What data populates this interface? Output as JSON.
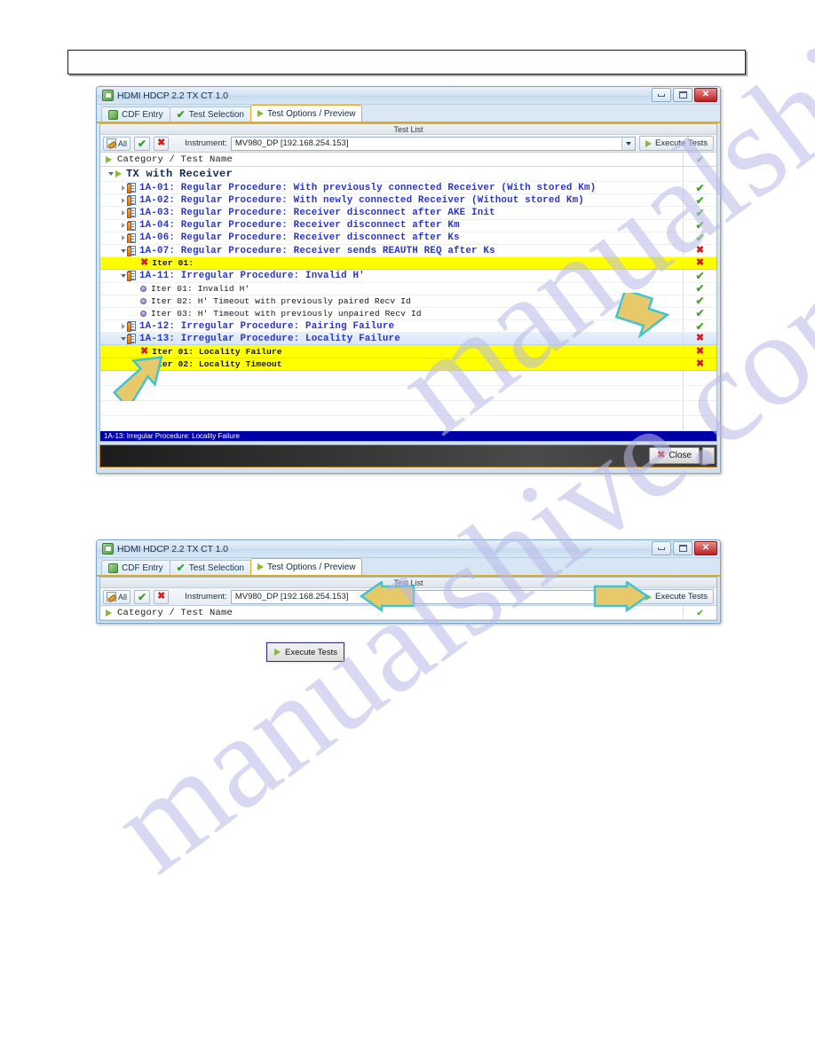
{
  "page": {
    "watermark": "manualshive.com",
    "header_box_text": ""
  },
  "window1": {
    "title": "HDMI HDCP 2.2 TX CT 1.0",
    "window_buttons": {
      "minimize": "—",
      "maximize": "❐",
      "close": "✕"
    },
    "tabs": [
      {
        "label": "CDF Entry",
        "icon": "cdf-icon",
        "active": false
      },
      {
        "label": "Test Selection",
        "icon": "check-icon",
        "active": false
      },
      {
        "label": "Test Options / Preview",
        "icon": "play-icon",
        "active": true
      }
    ],
    "panel_caption": "Test List",
    "toolbar": {
      "all_label": "All",
      "select_all_icon": "green-check-icon",
      "clear_all_icon": "red-x-icon",
      "instrument_label": "Instrument:",
      "instrument_value": "MV980_DP [192.168.254.153]",
      "execute_label": "Execute Tests"
    },
    "grid": {
      "header": "Category / Test Name",
      "header_status": "pass",
      "rows": [
        {
          "kind": "category",
          "indent": 0,
          "expander": "open",
          "icon": "play-icon",
          "text": "TX with Receiver",
          "status": "",
          "highlight": false
        },
        {
          "kind": "test",
          "indent": 1,
          "expander": "closed",
          "icon": "doc-icon",
          "text": "1A-01: Regular Procedure: With previously connected Receiver (With stored Km)",
          "status": "pass",
          "highlight": false
        },
        {
          "kind": "test",
          "indent": 1,
          "expander": "closed",
          "icon": "doc-icon",
          "text": "1A-02: Regular Procedure: With newly connected Receiver (Without stored Km)",
          "status": "pass",
          "highlight": false
        },
        {
          "kind": "test",
          "indent": 1,
          "expander": "closed",
          "icon": "doc-icon",
          "text": "1A-03: Regular Procedure: Receiver disconnect after AKE Init",
          "status": "pass",
          "highlight": false
        },
        {
          "kind": "test",
          "indent": 1,
          "expander": "closed",
          "icon": "doc-icon",
          "text": "1A-04: Regular Procedure: Receiver disconnect after Km",
          "status": "pass",
          "highlight": false
        },
        {
          "kind": "test",
          "indent": 1,
          "expander": "closed",
          "icon": "doc-icon",
          "text": "1A-06: Regular Procedure: Receiver disconnect after Ks",
          "status": "pass",
          "highlight": false
        },
        {
          "kind": "test",
          "indent": 1,
          "expander": "open",
          "icon": "doc-icon",
          "text": "1A-07: Regular Procedure: Receiver sends REAUTH REQ after Ks",
          "status": "fail",
          "highlight": false
        },
        {
          "kind": "iter-fail",
          "indent": 2,
          "expander": "none",
          "icon": "red-x-icon",
          "text": "Iter 01:",
          "status": "fail",
          "highlight": true
        },
        {
          "kind": "test",
          "indent": 1,
          "expander": "open",
          "icon": "doc-icon",
          "text": "1A-11: Irregular Procedure: Invalid H'",
          "status": "pass",
          "highlight": false
        },
        {
          "kind": "iter",
          "indent": 2,
          "expander": "none",
          "icon": "bullet-icon",
          "text": "Iter 01: Invalid H'",
          "status": "pass",
          "highlight": false
        },
        {
          "kind": "iter",
          "indent": 2,
          "expander": "none",
          "icon": "bullet-icon",
          "text": "Iter 02: H' Timeout with previously paired Recv Id",
          "status": "pass",
          "highlight": false
        },
        {
          "kind": "iter",
          "indent": 2,
          "expander": "none",
          "icon": "bullet-icon",
          "text": "Iter 03: H' Timeout with previously unpaired Recv Id",
          "status": "pass",
          "highlight": false
        },
        {
          "kind": "test",
          "indent": 1,
          "expander": "closed",
          "icon": "doc-icon",
          "text": "1A-12: Irregular Procedure: Pairing Failure",
          "status": "pass",
          "highlight": false
        },
        {
          "kind": "test-sel",
          "indent": 1,
          "expander": "open",
          "icon": "doc-icon",
          "text": "1A-13: Irregular Procedure: Locality Failure",
          "status": "fail",
          "highlight": false
        },
        {
          "kind": "iter-fail",
          "indent": 2,
          "expander": "none",
          "icon": "red-x-icon",
          "text": "Iter 01: Locality Failure",
          "status": "fail",
          "highlight": true
        },
        {
          "kind": "iter-fail",
          "indent": 2,
          "expander": "none",
          "icon": "red-x-icon",
          "text": "Iter 02: Locality Timeout",
          "status": "fail",
          "highlight": true
        },
        {
          "kind": "empty",
          "indent": 0,
          "expander": "none",
          "icon": "",
          "text": "",
          "status": "",
          "highlight": false
        },
        {
          "kind": "empty",
          "indent": 0,
          "expander": "none",
          "icon": "",
          "text": "",
          "status": "",
          "highlight": false
        },
        {
          "kind": "empty",
          "indent": 0,
          "expander": "none",
          "icon": "",
          "text": "",
          "status": "",
          "highlight": false
        },
        {
          "kind": "empty",
          "indent": 0,
          "expander": "none",
          "icon": "",
          "text": "",
          "status": "",
          "highlight": false
        }
      ]
    },
    "status_bar": "1A-13: Irregular Procedure: Locality Failure",
    "close_label": "Close"
  },
  "window2": {
    "title": "HDMI HDCP 2.2 TX CT 1.0",
    "tabs": [
      {
        "label": "CDF Entry",
        "icon": "cdf-icon",
        "active": false
      },
      {
        "label": "Test Selection",
        "icon": "check-icon",
        "active": false
      },
      {
        "label": "Test Options / Preview",
        "icon": "play-icon",
        "active": true
      }
    ],
    "panel_caption": "Test List",
    "toolbar": {
      "all_label": "All",
      "instrument_label": "Instrument:",
      "instrument_value": "MV980_DP [192.168.254.153]",
      "execute_label": "Execute Tests"
    },
    "grid": {
      "header": "Category / Test Name",
      "header_status": "pass"
    }
  },
  "callout_button": {
    "label": "Execute Tests",
    "icon": "play-icon"
  },
  "colors": {
    "highlight": "#ffff00",
    "pass": "#46a62c",
    "fail": "#d12020",
    "test_text": "#2b35c8",
    "category_text": "#102a52",
    "status_bar_bg": "#0000a8",
    "arrow_fill": "#e8c96a",
    "arrow_stroke": "#3fc4d4",
    "tab_accent": "#e0a92a"
  }
}
